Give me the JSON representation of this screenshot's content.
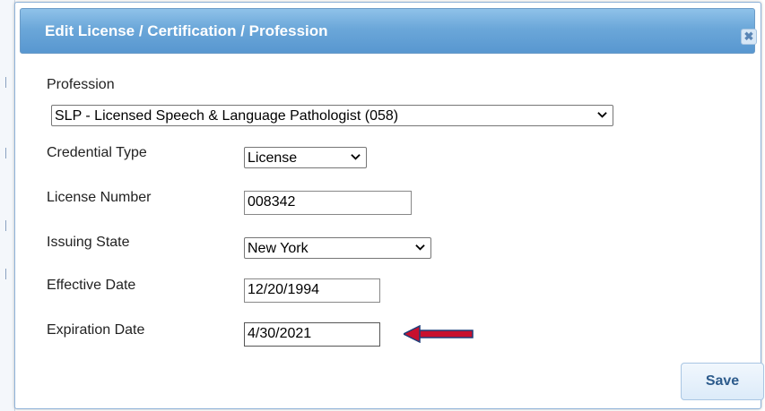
{
  "dialog": {
    "title": "Edit License / Certification / Profession",
    "close_icon": "close-icon"
  },
  "form": {
    "profession": {
      "label": "Profession",
      "value": "SLP - Licensed Speech & Language Pathologist (058)"
    },
    "credential_type": {
      "label": "Credential Type",
      "value": "License"
    },
    "license_number": {
      "label": "License Number",
      "value": "008342"
    },
    "issuing_state": {
      "label": "Issuing State",
      "value": "New York"
    },
    "effective_date": {
      "label": "Effective Date",
      "value": "12/20/1994"
    },
    "expiration_date": {
      "label": "Expiration Date",
      "value": "4/30/2021"
    }
  },
  "actions": {
    "save_label": "Save"
  },
  "colors": {
    "title_bar": "#6ba7d9",
    "arrow": "#c8102e"
  }
}
